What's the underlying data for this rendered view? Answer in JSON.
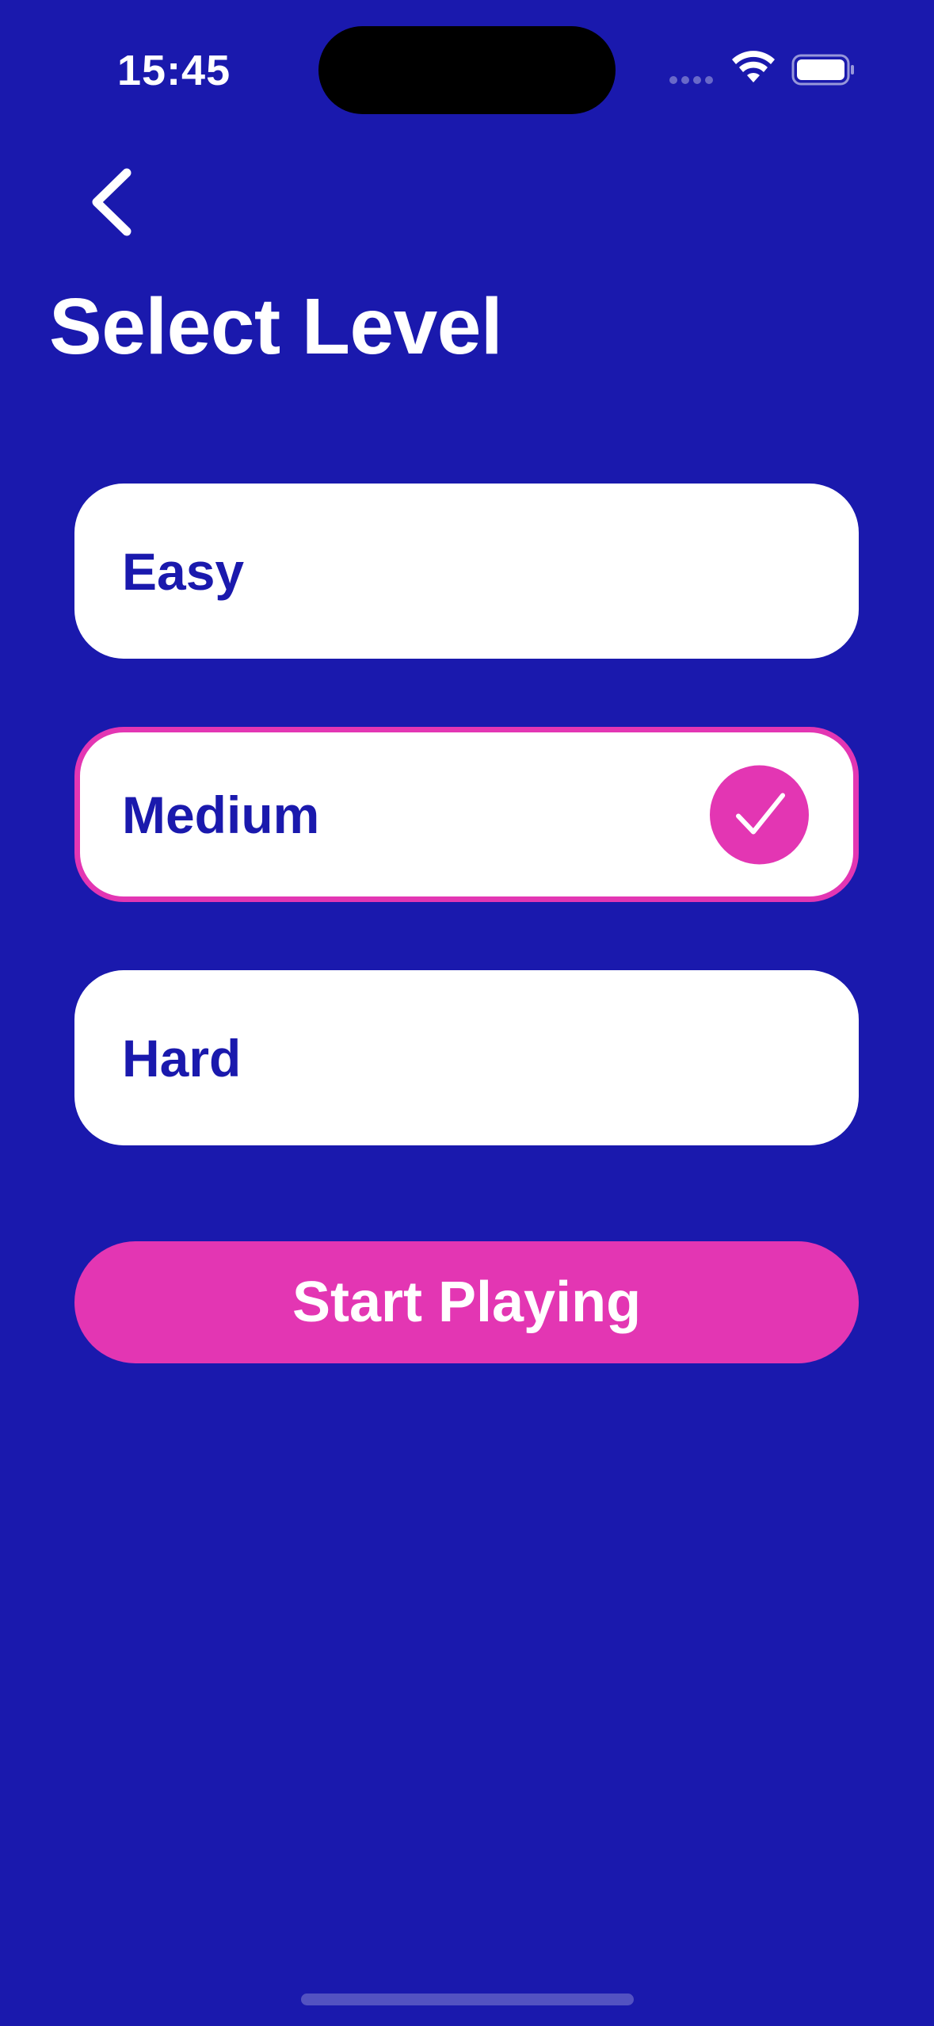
{
  "status_bar": {
    "time": "15:45"
  },
  "header": {
    "back_icon": "chevron-left-icon",
    "title": "Select Level"
  },
  "levels": [
    {
      "label": "Easy",
      "selected": false
    },
    {
      "label": "Medium",
      "selected": true
    },
    {
      "label": "Hard",
      "selected": false
    }
  ],
  "actions": {
    "start_label": "Start Playing"
  },
  "colors": {
    "background": "#1a19ad",
    "accent": "#e336b3",
    "card": "#ffffff",
    "text_on_card": "#1a19ad"
  }
}
